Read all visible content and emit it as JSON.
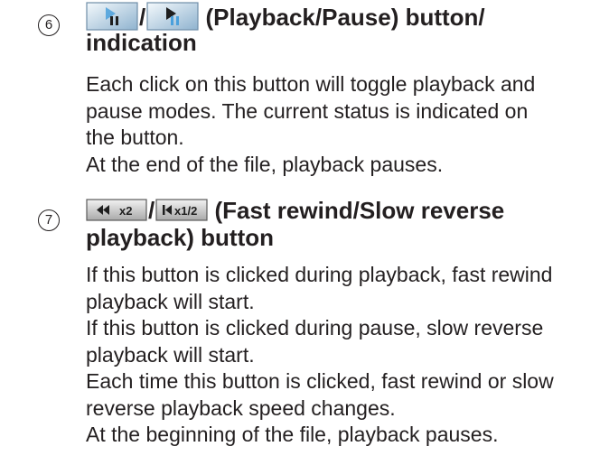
{
  "items": [
    {
      "number": "6",
      "heading_text": "(Playback/Pause) button/",
      "heading_line2": "indication",
      "icons": [
        "playback-button-icon",
        "pause-button-icon"
      ],
      "separator": "/",
      "body": [
        "Each click on this button will toggle playback and",
        "pause modes. The current status is indicated on",
        "the button.",
        "At the end of the file, playback pauses."
      ]
    },
    {
      "number": "7",
      "heading_text": "(Fast rewind/Slow reverse",
      "heading_line2": "playback) button",
      "icons": [
        "fast-rewind-button-icon",
        "slow-reverse-button-icon"
      ],
      "icon_labels": [
        "x2",
        "x1/2"
      ],
      "separator": "/",
      "body": [
        "If this button is clicked during playback, fast rewind",
        "playback will start.",
        "If this button is clicked during pause, slow reverse",
        "playback will start.",
        "Each time this button is clicked, fast rewind or slow",
        "reverse playback speed changes.",
        "At the beginning of the file, playback pauses."
      ]
    }
  ],
  "colors": {
    "text": "#231f20",
    "button_light": "#e6f1f8",
    "button_dark": "#7fa7c7",
    "icon_dark": "#1e1e1e"
  }
}
